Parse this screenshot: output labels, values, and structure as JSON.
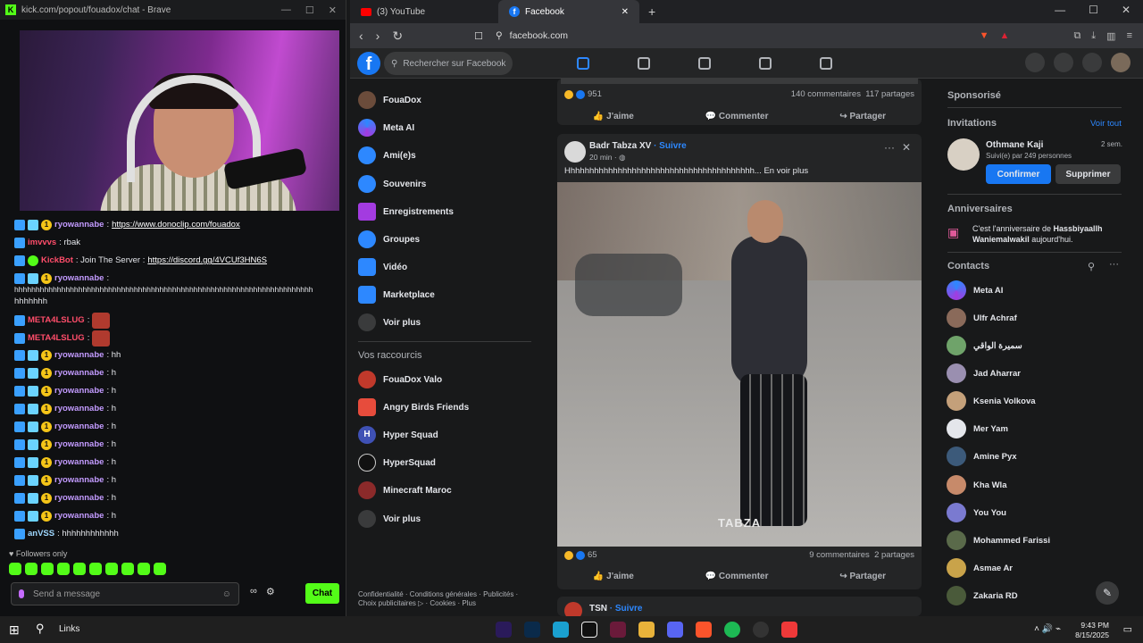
{
  "kick_window": {
    "title": "kick.com/popout/fouadox/chat - Brave",
    "chat": [
      {
        "user": "ryowannabe",
        "text": ": ",
        "link": "https://www.donoclip.com/fouadox"
      },
      {
        "user": "imvvvs",
        "text": ": rbak"
      },
      {
        "user": "KickBot",
        "text": ": Join The Server : ",
        "link": "https://discord.gg/4VCUf3HN6S"
      },
      {
        "user": "ryowannabe",
        "text": ":"
      },
      {
        "text": "hhhhhhhhhhhhhhhhhhhhhhhhhhhhhhhhhhhhhhhhhhhhhhhhhhhhhhhhhhhhhhhhhhhhhh"
      },
      {
        "text": "hhhhhhh"
      },
      {
        "user": "META4LSLUG",
        "text": ":"
      },
      {
        "user": "META4LSLUG",
        "text": ":"
      },
      {
        "user": "ryowannabe",
        "text": ": hh"
      },
      {
        "user": "ryowannabe",
        "text": ": h"
      },
      {
        "user": "ryowannabe",
        "text": ": h"
      },
      {
        "user": "ryowannabe",
        "text": ": h"
      },
      {
        "user": "ryowannabe",
        "text": ": h"
      },
      {
        "user": "ryowannabe",
        "text": ": h"
      },
      {
        "user": "ryowannabe",
        "text": ": h"
      },
      {
        "user": "ryowannabe",
        "text": ": h"
      },
      {
        "user": "ryowannabe",
        "text": ": h"
      },
      {
        "user": "ryowannabe",
        "text": ": h"
      },
      {
        "user": "anVSS",
        "text": ": hhhhhhhhhhhh"
      }
    ],
    "followers_only": "Followers only",
    "send_placeholder": "Send a message",
    "chat_button": "Chat"
  },
  "browser": {
    "tabs": [
      {
        "label": "(3) YouTube"
      },
      {
        "label": "Facebook"
      }
    ],
    "url": "facebook.com"
  },
  "facebook": {
    "search_placeholder": "Rechercher sur Facebook",
    "left_menu": [
      {
        "label": "FouaDox",
        "color": "#6b4c3b"
      },
      {
        "label": "Meta AI",
        "color": "#2d88ff"
      },
      {
        "label": "Ami(e)s",
        "color": "#2d88ff"
      },
      {
        "label": "Souvenirs",
        "color": "#2d88ff"
      },
      {
        "label": "Enregistrements",
        "color": "#a33be0"
      },
      {
        "label": "Groupes",
        "color": "#2d88ff"
      },
      {
        "label": "Vidéo",
        "color": "#2d88ff"
      },
      {
        "label": "Marketplace",
        "color": "#2d88ff"
      },
      {
        "label": "Voir plus",
        "color": "#3a3b3c"
      }
    ],
    "shortcuts_title": "Vos raccourcis",
    "shortcuts": [
      {
        "label": "FouaDox Valo",
        "color": "#c0392b"
      },
      {
        "label": "Angry Birds Friends",
        "color": "#e74c3c"
      },
      {
        "label": "Hyper Squad",
        "color": "#3f51b5"
      },
      {
        "label": "HyperSquad",
        "color": "#111111"
      },
      {
        "label": "Minecraft Maroc",
        "color": "#8b2a2a"
      },
      {
        "label": "Voir plus",
        "color": "#3a3b3c"
      }
    ],
    "legal": "Confidentialité · Conditions générales · Publicités · Choix publicitaires ▷ · Cookies · Plus",
    "post0": {
      "reactions": "951",
      "comments": "140 commentaires",
      "shares": "117 partages"
    },
    "actions": {
      "like": "J'aime",
      "comment": "Commenter",
      "share": "Partager"
    },
    "post1": {
      "author": "Badr Tabza XV",
      "follow": "· Suivre",
      "time": "20 min · ",
      "text": "Hhhhhhhhhhhhhhhhhhhhhhhhhhhhhhhhhhhhhhhh... En voir plus",
      "watermark": "TABZA",
      "reactions": "65",
      "comments": "9 commentaires",
      "shares": "2 partages"
    },
    "post2": {
      "author": "TSN",
      "follow": "· Suivre"
    },
    "sponsored": "Sponsorisé",
    "invitations_title": "Invitations",
    "see_all": "Voir tout",
    "invite": {
      "name": "Othmane Kaji",
      "time": "2 sem.",
      "mutual": "Suivi(e) par 249 personnes",
      "confirm": "Confirmer",
      "delete": "Supprimer"
    },
    "birthdays_title": "Anniversaires",
    "birthday_pre": "C'est l'anniversaire de ",
    "birthday_name": "Hassbiyaallh Waniemalwakil",
    "birthday_post": " aujourd'hui.",
    "contacts_title": "Contacts",
    "contacts": [
      {
        "name": "Meta AI",
        "color": "#2d88ff"
      },
      {
        "name": "Ulfr Achraf",
        "color": "#8a6a5a"
      },
      {
        "name": "سميرة الواقي",
        "color": "#6fa36a"
      },
      {
        "name": "Jad Aharrar",
        "color": "#9a8fb0"
      },
      {
        "name": "Ksenia Volkova",
        "color": "#c4a07a"
      },
      {
        "name": "Mer Yam",
        "color": "#e4e6eb"
      },
      {
        "name": "Amine Pyx",
        "color": "#3c5a7a"
      },
      {
        "name": "Kha Wla",
        "color": "#c78a6a"
      },
      {
        "name": "You You",
        "color": "#7a7ad0"
      },
      {
        "name": "Mohammed Farissi",
        "color": "#5a6a4a"
      },
      {
        "name": "Asmae Ar",
        "color": "#c9a34a"
      },
      {
        "name": "Zakaria RD",
        "color": "#4a5a3a"
      }
    ]
  },
  "taskbar": {
    "search": "Links",
    "time": "9:43 PM",
    "date": "8/15/2025"
  }
}
